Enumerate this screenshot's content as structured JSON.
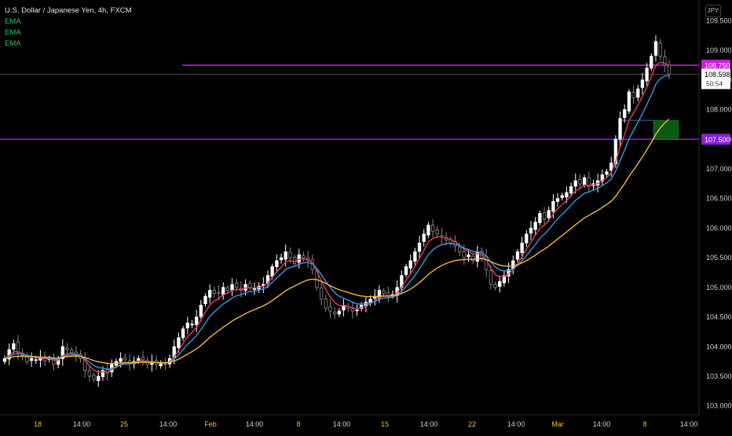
{
  "legend": {
    "title": "U.S. Dollar / Japanese Yen, 4h, FXCM",
    "indicators": [
      "EMA",
      "EMA",
      "EMA"
    ]
  },
  "currency_button": "JPY",
  "countdown": "50:54",
  "colors": {
    "background": "#000000",
    "up_candle": "#ffffff",
    "down_candle": "#8a8a8a",
    "ema_fast": "#e23c5a",
    "ema_mid": "#2f9be0",
    "ema_slow": "#f5b43c",
    "level_line": "#d01ce0",
    "support_line": "#8c1ce0",
    "target_box": "#0b5a16",
    "axis_text": "#d0d0d0",
    "date_text": "#f0c020"
  },
  "chart_data": {
    "type": "candlestick",
    "title": "U.S. Dollar / Japanese Yen, 4h, FXCM",
    "symbol": "USDJPY",
    "timeframe": "4h",
    "xlabel": "",
    "ylabel": "",
    "ylim": [
      102.85,
      109.85
    ],
    "y_ticks": [
      "103.000",
      "103.500",
      "104.000",
      "104.500",
      "105.000",
      "105.500",
      "106.000",
      "106.500",
      "107.000",
      "107.500",
      "108.000",
      "108.500",
      "109.000",
      "109.500"
    ],
    "x_ticks": [
      "18",
      "14:00",
      "25",
      "14:00",
      "Feb",
      "14:00",
      "8",
      "14:00",
      "15",
      "14:00",
      "22",
      "14:00",
      "Mar",
      "14:00",
      "8",
      "14:00"
    ],
    "last_price": 108.598,
    "horizontal_levels": [
      {
        "value": 108.75,
        "label": "108.750"
      },
      {
        "value": 107.5,
        "label": "107.500"
      }
    ],
    "target_zone": {
      "low": 107.5,
      "high": 107.82
    },
    "close_series": [
      103.8,
      103.95,
      104.05,
      103.9,
      103.85,
      103.75,
      103.8,
      103.78,
      103.82,
      103.76,
      103.8,
      103.7,
      103.78,
      104.0,
      103.95,
      103.9,
      103.85,
      103.8,
      103.6,
      103.5,
      103.45,
      103.5,
      103.6,
      103.55,
      103.7,
      103.75,
      103.8,
      103.78,
      103.72,
      103.75,
      103.8,
      103.78,
      103.7,
      103.75,
      103.7,
      103.72,
      103.7,
      103.8,
      104.0,
      104.15,
      104.3,
      104.4,
      104.38,
      104.5,
      104.7,
      104.85,
      104.95,
      104.9,
      104.9,
      105.0,
      104.95,
      105.05,
      105.0,
      104.95,
      105.05,
      105.0,
      104.98,
      105.02,
      105.05,
      105.2,
      105.35,
      105.45,
      105.5,
      105.6,
      105.5,
      105.4,
      105.55,
      105.5,
      105.45,
      105.3,
      105.0,
      104.8,
      104.65,
      104.6,
      104.55,
      104.6,
      104.7,
      104.65,
      104.6,
      104.62,
      104.7,
      104.75,
      104.8,
      104.85,
      104.95,
      104.9,
      104.85,
      104.88,
      105.0,
      105.2,
      105.35,
      105.45,
      105.6,
      105.75,
      105.9,
      106.05,
      105.95,
      105.9,
      105.85,
      105.8,
      105.75,
      105.7,
      105.6,
      105.5,
      105.55,
      105.45,
      105.6,
      105.5,
      105.3,
      105.05,
      105.0,
      105.1,
      105.2,
      105.3,
      105.45,
      105.6,
      105.75,
      105.9,
      106.0,
      106.1,
      106.25,
      106.15,
      106.3,
      106.45,
      106.5,
      106.55,
      106.6,
      106.7,
      106.8,
      106.75,
      106.85,
      106.7,
      106.75,
      106.8,
      106.9,
      106.95,
      107.1,
      107.5,
      107.85,
      108.0,
      108.3,
      108.2,
      108.35,
      108.5,
      108.7,
      108.9,
      109.15,
      108.9,
      108.75,
      108.6
    ]
  }
}
